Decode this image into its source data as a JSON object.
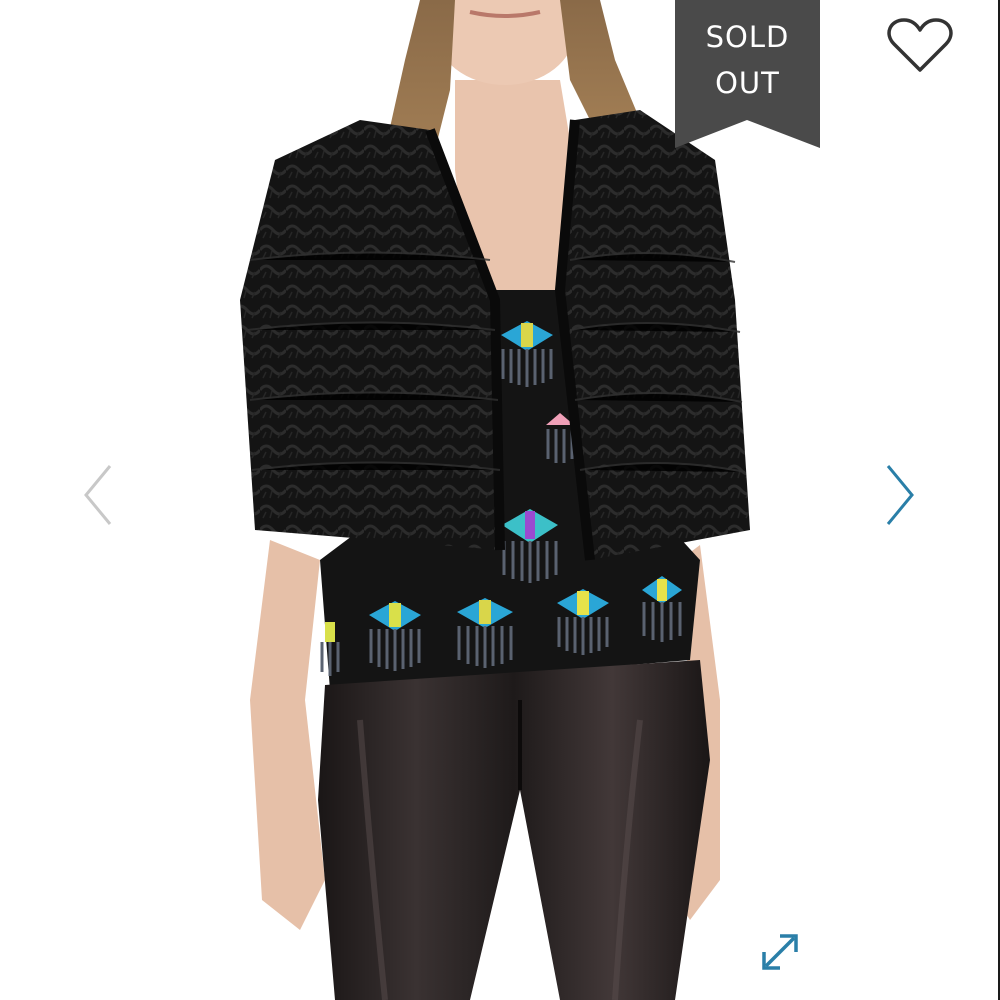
{
  "badge": {
    "line1": "SOLD",
    "line2": "OUT",
    "color": "#4a4a4a"
  },
  "icons": {
    "favorite": "heart-outline-icon",
    "previous": "chevron-left-icon",
    "next": "chevron-right-icon",
    "expand": "expand-arrows-icon"
  },
  "colors": {
    "arrow_inactive": "#c8c8c8",
    "arrow_active": "#2a7fa8",
    "expand": "#2a7fa8",
    "heart": "#333333"
  }
}
